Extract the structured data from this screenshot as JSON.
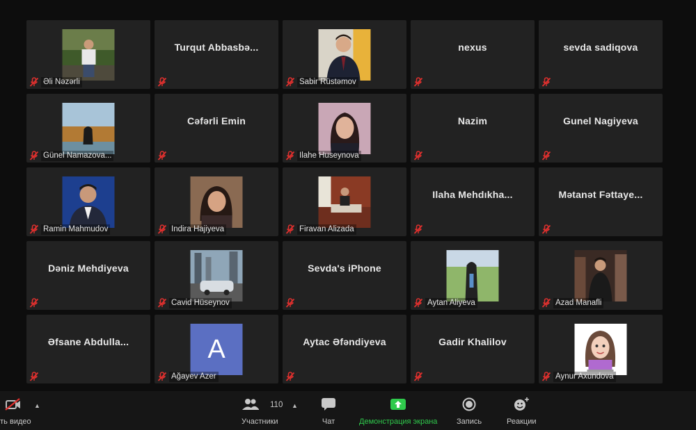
{
  "participants": [
    {
      "name": "Əli Nəzərli",
      "display": "",
      "photo": "photo-park"
    },
    {
      "name": "",
      "display": "Turqut  Abbasbə...",
      "photo": ""
    },
    {
      "name": "Sabir Rüstəmov",
      "display": "",
      "photo": "photo-suit-young"
    },
    {
      "name": "",
      "display": "nexus",
      "photo": ""
    },
    {
      "name": "",
      "display": "sevda sadiqova",
      "photo": ""
    },
    {
      "name": "Günel Namazova...",
      "display": "",
      "photo": "photo-landscape"
    },
    {
      "name": "",
      "display": "Cəfərli Emin",
      "photo": ""
    },
    {
      "name": "Ilahe Huseynova",
      "display": "",
      "photo": "photo-woman-dark-hair"
    },
    {
      "name": "",
      "display": "Nazim",
      "photo": ""
    },
    {
      "name": "",
      "display": "Gunel Nagiyeva",
      "photo": ""
    },
    {
      "name": "Ramin Mahmudov",
      "display": "",
      "photo": "photo-suit-blue"
    },
    {
      "name": "Indira Hajiyeva",
      "display": "",
      "photo": "photo-woman-portrait"
    },
    {
      "name": "Firavan Alizada",
      "display": "",
      "photo": "photo-office"
    },
    {
      "name": "",
      "display": "Ilaha  Mehdıkha...",
      "photo": ""
    },
    {
      "name": "",
      "display": "Mətanət  Fəttaye...",
      "photo": ""
    },
    {
      "name": "",
      "display": "Dəniz Mehdiyeva",
      "photo": ""
    },
    {
      "name": "Cavid Hüseynov",
      "display": "",
      "photo": "photo-city-car"
    },
    {
      "name": "",
      "display": "Sevda's iPhone",
      "photo": ""
    },
    {
      "name": "Aytan Aliyeva",
      "display": "",
      "photo": "photo-woman-outdoor"
    },
    {
      "name": "Azad Manafli",
      "display": "",
      "photo": "photo-man-event"
    },
    {
      "name": "",
      "display": "Əfsane  Abdulla...",
      "photo": ""
    },
    {
      "name": "Ağayev Azer",
      "display": "",
      "photo": "avatar-letter",
      "letter": "A"
    },
    {
      "name": "",
      "display": "Aytac Əfəndiyeva",
      "photo": ""
    },
    {
      "name": "",
      "display": "Gadir Khalilov",
      "photo": ""
    },
    {
      "name": "Aynur Axundova",
      "display": "",
      "photo": "photo-cartoon"
    }
  ],
  "toolbar": {
    "video_label": "ить видео",
    "participants_label": "Участники",
    "participants_count": "110",
    "chat_label": "Чат",
    "share_label": "Демонстрация экрана",
    "record_label": "Запись",
    "reactions_label": "Реакции"
  },
  "colors": {
    "tile": "#222222",
    "muted_red": "#e0302e",
    "share_green": "#2fca4c",
    "avatar_letter_bg": "#5b6fc2"
  }
}
